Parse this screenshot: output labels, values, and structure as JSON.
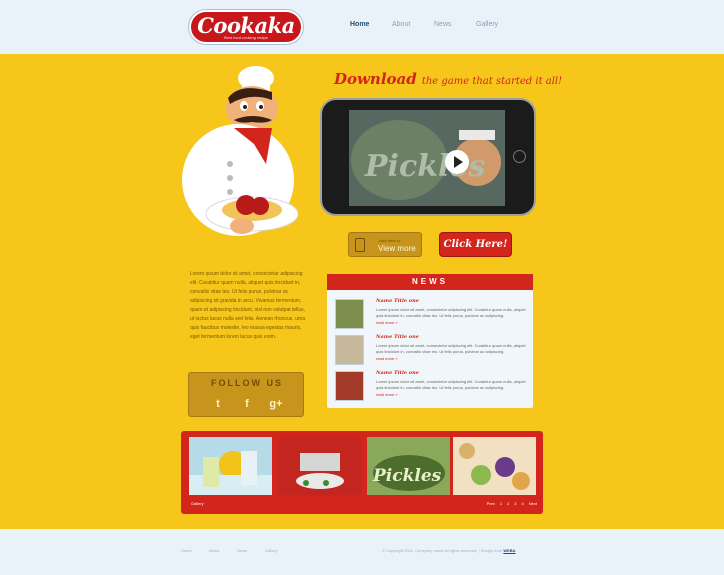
{
  "header": {
    "logo_text": "Cookaka",
    "logo_tagline": "Best food cooking recipe",
    "nav": [
      "Home",
      "About",
      "News",
      "Gallery"
    ]
  },
  "hero": {
    "download_big": "Download",
    "download_small": "the game that started it all!",
    "video_label": "Pickles",
    "view_more_small": "click here to",
    "view_more_label": "View more",
    "click_here_label": "Click Here!"
  },
  "intro_text": "Lorem ipsum dolor sit amet, consectetur adipiscing elit. Curabitur quam nulla, aliquet quis tincidunt in, convallis vitae leo. Ut felis purus, pulvinar ac adipiscing sit gravida in arcu. Vivamus fermentum, quam et adipiscing tincidunt, nisl non volutpat tellus, ut luctus lacus nulla sed felis. Aenean rhoncus, urna quis faucibus molestie, leo massa egestas mauris, eget fermentum lorem lacus quis enim.",
  "follow": {
    "title": "FOLLOW US",
    "icons": [
      "twitter-icon",
      "facebook-icon",
      "google-plus-icon"
    ],
    "icon_glyphs": [
      "t",
      "f",
      "g+"
    ]
  },
  "news": {
    "title": "NEWS",
    "items": [
      {
        "title": "Name Title one",
        "text": "Lorem ipsum dolor sit amet, consectetur adipiscing elit. Curabitur quam nulla, aliquet quis tincidunt in, convallis vitae leo. Ut felis purus, pulvinar ac adipiscing.",
        "more": "read more »"
      },
      {
        "title": "Name Title one",
        "text": "Lorem ipsum dolor sit amet, consectetur adipiscing elit. Curabitur quam nulla, aliquet quis tincidunt in, convallis vitae leo. Ut felis purus, pulvinar ac adipiscing.",
        "more": "read more »"
      },
      {
        "title": "Name Title one",
        "text": "Lorem ipsum dolor sit amet, consectetur adipiscing elit. Curabitur quam nulla, aliquet quis tincidunt in, convallis vitae leo. Ut felis purus, pulvinar ac adipiscing.",
        "more": "read more »"
      }
    ]
  },
  "gallery": {
    "label": "Gallery",
    "pages": [
      "Prev",
      "1",
      "2",
      "3",
      "4",
      "Next"
    ],
    "pickles_word": "Pickles"
  },
  "footer": {
    "nav": [
      "Home",
      "About",
      "News",
      "Gallery"
    ],
    "copyright": "© Copyright 2011. Company name All rights reserved. | Design from",
    "link": "WEBA"
  },
  "colors": {
    "brand_red": "#d3251b",
    "stage_yellow": "#f6c61b",
    "button_gold": "#c8951c",
    "header_bg": "#eaf2f9"
  }
}
